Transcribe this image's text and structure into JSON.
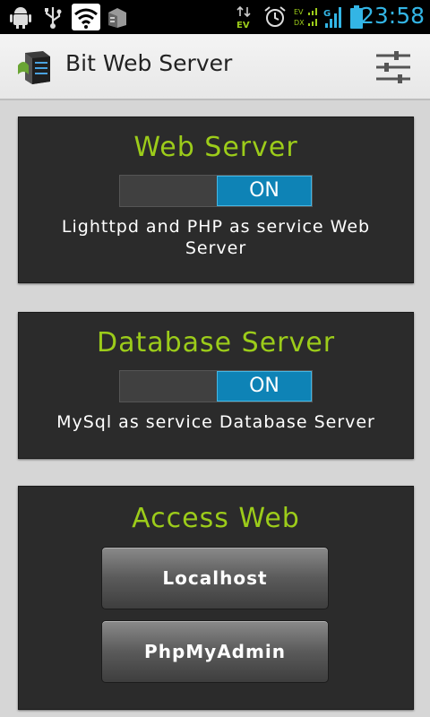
{
  "status_bar": {
    "time": "23:58",
    "icons": [
      "android-debug-icon",
      "usb-icon",
      "wifi-icon",
      "server-notification-icon",
      "data-transfer-icon",
      "alarm-icon",
      "signal-icon",
      "battery-icon"
    ],
    "data_label": "EV",
    "signal_labels": [
      "EV",
      "DX"
    ],
    "network_type": "G"
  },
  "action_bar": {
    "title": "Bit Web Server",
    "settings_icon": "settings-sliders-icon"
  },
  "cards": {
    "web_server": {
      "title": "Web Server",
      "toggle_state": "ON",
      "description": "Lighttpd and PHP as service Web Server"
    },
    "database_server": {
      "title": "Database Server",
      "toggle_state": "ON",
      "description": "MySql as service Database Server"
    },
    "access_web": {
      "title": "Access Web",
      "buttons": [
        "Localhost",
        "PhpMyAdmin"
      ]
    }
  },
  "colors": {
    "accent_green": "#9ccc1a",
    "toggle_blue": "#0e83b6",
    "clock_blue": "#33b5e5",
    "card_bg": "#2b2b2b"
  }
}
